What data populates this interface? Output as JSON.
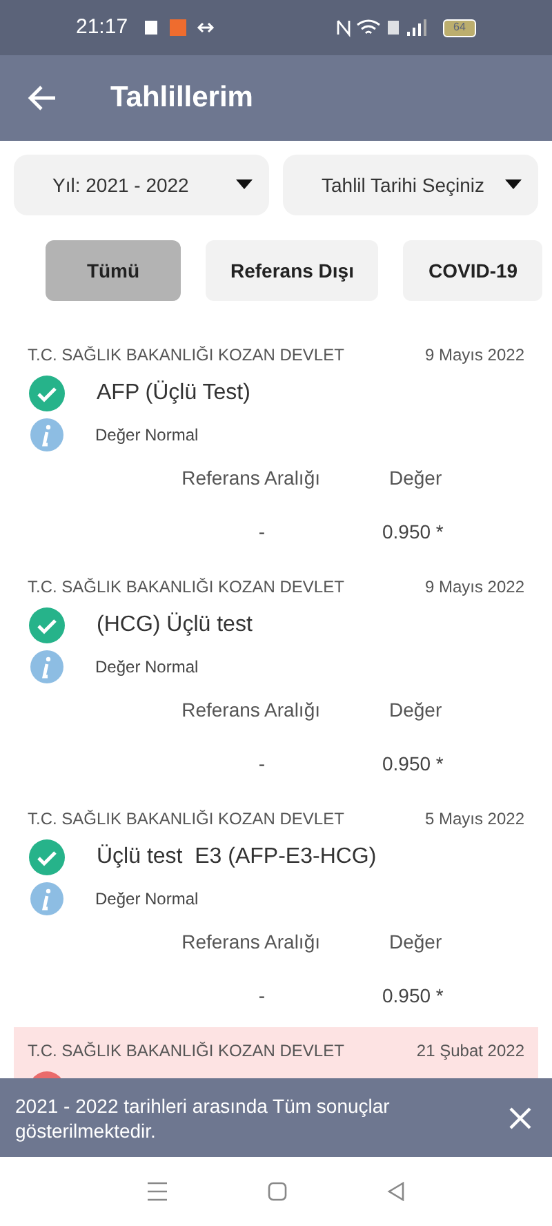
{
  "status_bar": {
    "time": "21:17",
    "battery": "64"
  },
  "header": {
    "title": "Tahlillerim"
  },
  "filters": [
    {
      "label": "Yıl: 2021 - 2022"
    },
    {
      "label": "Tahlil Tarihi Seçiniz"
    }
  ],
  "chips": [
    {
      "label": "Tümü",
      "selected": true
    },
    {
      "label": "Referans Dışı",
      "selected": false
    },
    {
      "label": "COVID-19",
      "selected": false
    }
  ],
  "results": [
    {
      "kind": "normal",
      "institution": "T.C. SAĞLIK BAKANLIĞI KOZAN DEVLET",
      "date": "9 Mayıs 2022",
      "name": "AFP (Üçlü Test)",
      "note": "Değer Normal",
      "range_label": "Referans Aralığı",
      "value_label": "Değer",
      "range": "-",
      "value": "0.950 *"
    },
    {
      "kind": "normal",
      "institution": "T.C. SAĞLIK BAKANLIĞI KOZAN DEVLET",
      "date": "9 Mayıs 2022",
      "name": "(HCG) Üçlü test",
      "note": "Değer Normal",
      "range_label": "Referans Aralığı",
      "value_label": "Değer",
      "range": "-",
      "value": "0.950 *"
    },
    {
      "kind": "normal",
      "institution": "T.C. SAĞLIK BAKANLIĞI KOZAN DEVLET",
      "date": "5 Mayıs 2022",
      "name": "Üçlü test  E3 (AFP-E3-HCG)",
      "note": "Değer Normal",
      "range_label": "Referans Aralığı",
      "value_label": "Değer",
      "range": "-",
      "value": "0.950 *"
    },
    {
      "kind": "abnormal",
      "institution": "T.C. SAĞLIK BAKANLIĞI KOZAN DEVLET",
      "date": "21 Şubat 2022"
    }
  ],
  "snackbar": {
    "message": "2021 - 2022 tarihleri arasında Tüm sonuçlar gösterilmektedir."
  }
}
